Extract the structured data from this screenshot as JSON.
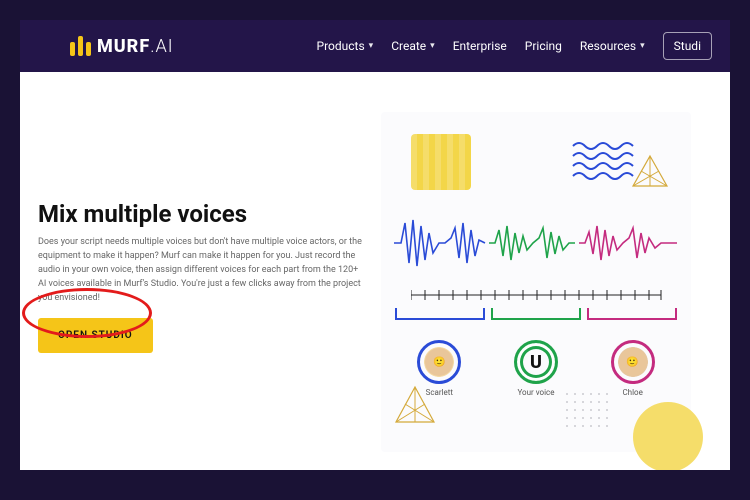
{
  "brand": {
    "name": "MURF",
    "suffix": ".AI"
  },
  "nav": {
    "products": "Products",
    "create": "Create",
    "enterprise": "Enterprise",
    "pricing": "Pricing",
    "resources": "Resources",
    "studio": "Studi"
  },
  "hero": {
    "heading": "Mix multiple voices",
    "body": "Does your script needs multiple voices but don't have multiple voice actors, or the equipment to make it happen? Murf can make it happen for you. Just record the audio in your own voice, then assign different voices for each part from the 120+ AI voices available in Murf's Studio. You're just a few clicks away from the project you envisioned!",
    "cta": "OPEN STUDIO"
  },
  "illustration": {
    "avatars": [
      {
        "name": "Scarlett",
        "letter": ""
      },
      {
        "name": "Your voice",
        "letter": "U"
      },
      {
        "name": "Chloe",
        "letter": ""
      }
    ]
  },
  "colors": {
    "accent": "#f5c518",
    "wave_blue": "#2a4bd7",
    "wave_green": "#1fa34a",
    "wave_pink": "#c42b7f"
  }
}
